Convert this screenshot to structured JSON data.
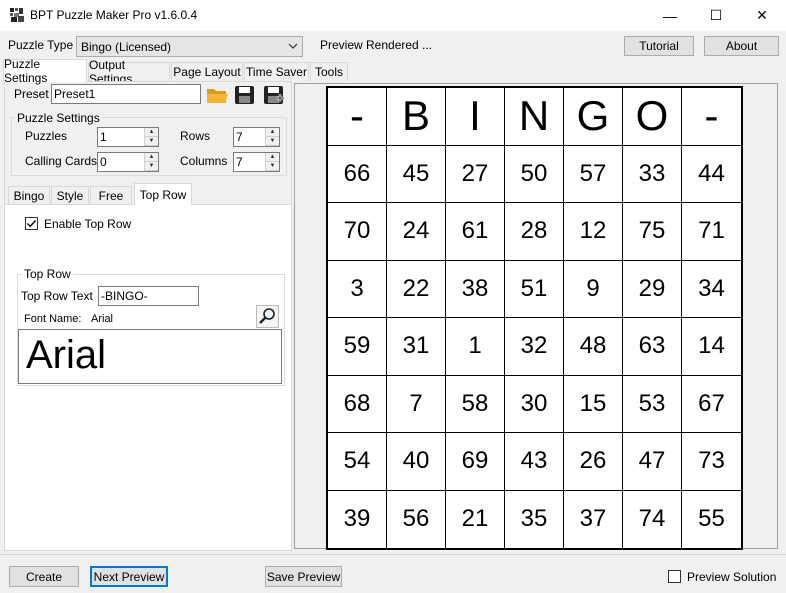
{
  "window": {
    "title": "BPT Puzzle Maker Pro v1.6.0.4",
    "controls": {
      "minimize": "—",
      "maximize": "☐",
      "close": "✕"
    }
  },
  "toolbar": {
    "puzzle_type_label": "Puzzle Type",
    "puzzle_type_value": "Bingo (Licensed)",
    "status": "Preview Rendered ...",
    "tutorial_label": "Tutorial",
    "about_label": "About"
  },
  "tabs": [
    "Puzzle Settings",
    "Output Settings",
    "Page Layout",
    "Time Saver",
    "Tools"
  ],
  "preset": {
    "label": "Preset",
    "value": "Preset1"
  },
  "puzzle_settings": {
    "title": "Puzzle Settings",
    "puzzles_label": "Puzzles",
    "puzzles_value": "1",
    "rows_label": "Rows",
    "rows_value": "7",
    "calling_cards_label": "Calling Cards",
    "calling_cards_value": "0",
    "columns_label": "Columns",
    "columns_value": "7"
  },
  "inner_tabs": [
    "Bingo",
    "Style",
    "Free",
    "Top Row"
  ],
  "top_row": {
    "enable_label": "Enable Top Row",
    "enable_checked": true,
    "group_title": "Top Row",
    "text_label": "Top Row Text",
    "text_value": "-BINGO-",
    "font_name_label": "Font Name:",
    "font_name_value": "Arial",
    "font_preview": "Arial"
  },
  "bingo": {
    "header": [
      "-",
      "B",
      "I",
      "N",
      "G",
      "O",
      "-"
    ],
    "rows": [
      [
        "66",
        "45",
        "27",
        "50",
        "57",
        "33",
        "44"
      ],
      [
        "70",
        "24",
        "61",
        "28",
        "12",
        "75",
        "71"
      ],
      [
        "3",
        "22",
        "38",
        "51",
        "9",
        "29",
        "34"
      ],
      [
        "59",
        "31",
        "1",
        "32",
        "48",
        "63",
        "14"
      ],
      [
        "68",
        "7",
        "58",
        "30",
        "15",
        "53",
        "67"
      ],
      [
        "54",
        "40",
        "69",
        "43",
        "26",
        "47",
        "73"
      ],
      [
        "39",
        "56",
        "21",
        "35",
        "37",
        "74",
        "55"
      ]
    ]
  },
  "bottom": {
    "create_label": "Create",
    "next_preview_label": "Next Preview",
    "save_preview_label": "Save Preview",
    "preview_solution_label": "Preview Solution",
    "preview_solution_checked": false
  },
  "colors": {
    "accent": "#0078d7",
    "folder": "#e8a317"
  }
}
